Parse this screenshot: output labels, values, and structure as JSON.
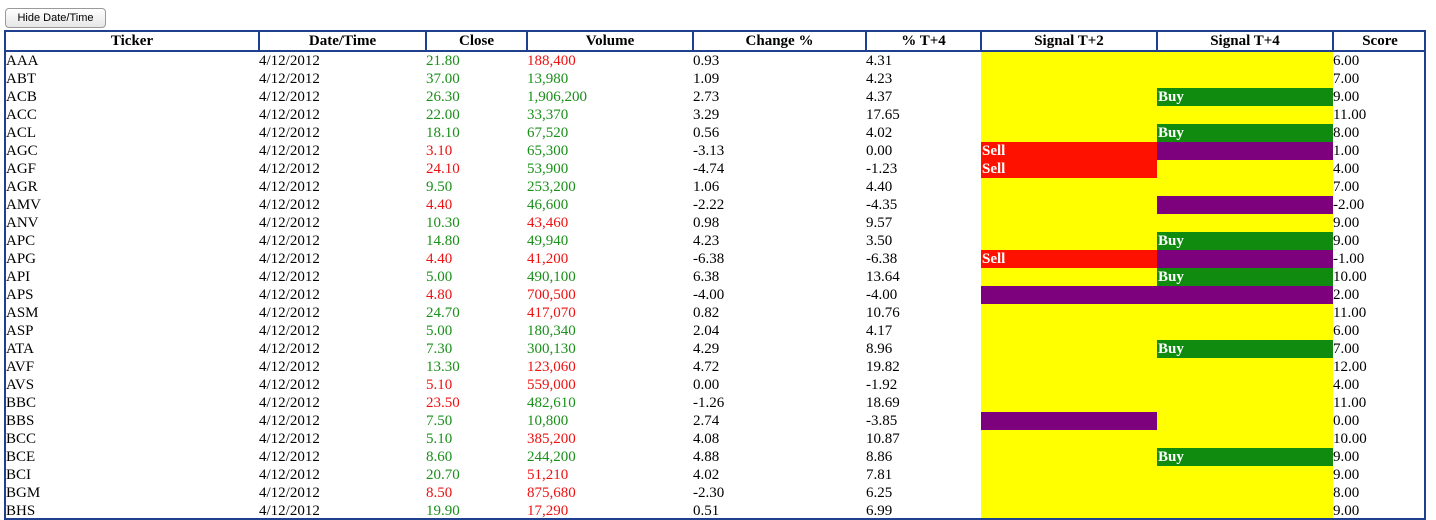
{
  "toolbar": {
    "toggle_label": "Hide Date/Time"
  },
  "colors": {
    "up": "#1a8f1a",
    "down": "#ee1111",
    "signal_bg": "#ffff00",
    "buy": "#108b10",
    "sell": "#ff1100",
    "purple": "#7d007d",
    "border": "#1f3f8f"
  },
  "table": {
    "headers": [
      "Ticker",
      "Date/Time",
      "Close",
      "Volume",
      "Change %",
      "% T+4",
      "Signal T+2",
      "Signal T+4",
      "Score"
    ],
    "rows": [
      {
        "ticker": "AAA",
        "date": "4/12/2012",
        "close": "21.80",
        "close_dir": "up",
        "volume": "188,400",
        "volume_dir": "down",
        "change": "0.93",
        "t4": "4.31",
        "sig2_kind": "none",
        "sig2": "",
        "sig4_kind": "none",
        "sig4": "",
        "score": "6.00"
      },
      {
        "ticker": "ABT",
        "date": "4/12/2012",
        "close": "37.00",
        "close_dir": "up",
        "volume": "13,980",
        "volume_dir": "up",
        "change": "1.09",
        "t4": "4.23",
        "sig2_kind": "none",
        "sig2": "",
        "sig4_kind": "none",
        "sig4": "",
        "score": "7.00"
      },
      {
        "ticker": "ACB",
        "date": "4/12/2012",
        "close": "26.30",
        "close_dir": "up",
        "volume": "1,906,200",
        "volume_dir": "up",
        "change": "2.73",
        "t4": "4.37",
        "sig2_kind": "none",
        "sig2": "",
        "sig4_kind": "buy",
        "sig4": "Buy",
        "score": "9.00"
      },
      {
        "ticker": "ACC",
        "date": "4/12/2012",
        "close": "22.00",
        "close_dir": "up",
        "volume": "33,370",
        "volume_dir": "up",
        "change": "3.29",
        "t4": "17.65",
        "sig2_kind": "none",
        "sig2": "",
        "sig4_kind": "none",
        "sig4": "",
        "score": "11.00"
      },
      {
        "ticker": "ACL",
        "date": "4/12/2012",
        "close": "18.10",
        "close_dir": "up",
        "volume": "67,520",
        "volume_dir": "up",
        "change": "0.56",
        "t4": "4.02",
        "sig2_kind": "none",
        "sig2": "",
        "sig4_kind": "buy",
        "sig4": "Buy",
        "score": "8.00"
      },
      {
        "ticker": "AGC",
        "date": "4/12/2012",
        "close": "3.10",
        "close_dir": "down",
        "volume": "65,300",
        "volume_dir": "up",
        "change": "-3.13",
        "t4": "0.00",
        "sig2_kind": "sell",
        "sig2": "Sell",
        "sig4_kind": "purple",
        "sig4": "",
        "score": "1.00"
      },
      {
        "ticker": "AGF",
        "date": "4/12/2012",
        "close": "24.10",
        "close_dir": "down",
        "volume": "53,900",
        "volume_dir": "up",
        "change": "-4.74",
        "t4": "-1.23",
        "sig2_kind": "sell",
        "sig2": "Sell",
        "sig4_kind": "none",
        "sig4": "",
        "score": "4.00"
      },
      {
        "ticker": "AGR",
        "date": "4/12/2012",
        "close": "9.50",
        "close_dir": "up",
        "volume": "253,200",
        "volume_dir": "up",
        "change": "1.06",
        "t4": "4.40",
        "sig2_kind": "none",
        "sig2": "",
        "sig4_kind": "none",
        "sig4": "",
        "score": "7.00"
      },
      {
        "ticker": "AMV",
        "date": "4/12/2012",
        "close": "4.40",
        "close_dir": "down",
        "volume": "46,600",
        "volume_dir": "up",
        "change": "-2.22",
        "t4": "-4.35",
        "sig2_kind": "none",
        "sig2": "",
        "sig4_kind": "purple",
        "sig4": "",
        "score": "-2.00"
      },
      {
        "ticker": "ANV",
        "date": "4/12/2012",
        "close": "10.30",
        "close_dir": "up",
        "volume": "43,460",
        "volume_dir": "down",
        "change": "0.98",
        "t4": "9.57",
        "sig2_kind": "none",
        "sig2": "",
        "sig4_kind": "none",
        "sig4": "",
        "score": "9.00"
      },
      {
        "ticker": "APC",
        "date": "4/12/2012",
        "close": "14.80",
        "close_dir": "up",
        "volume": "49,940",
        "volume_dir": "up",
        "change": "4.23",
        "t4": "3.50",
        "sig2_kind": "none",
        "sig2": "",
        "sig4_kind": "buy",
        "sig4": "Buy",
        "score": "9.00"
      },
      {
        "ticker": "APG",
        "date": "4/12/2012",
        "close": "4.40",
        "close_dir": "down",
        "volume": "41,200",
        "volume_dir": "down",
        "change": "-6.38",
        "t4": "-6.38",
        "sig2_kind": "sell",
        "sig2": "Sell",
        "sig4_kind": "purple",
        "sig4": "",
        "score": "-1.00"
      },
      {
        "ticker": "API",
        "date": "4/12/2012",
        "close": "5.00",
        "close_dir": "up",
        "volume": "490,100",
        "volume_dir": "up",
        "change": "6.38",
        "t4": "13.64",
        "sig2_kind": "none",
        "sig2": "",
        "sig4_kind": "buy",
        "sig4": "Buy",
        "score": "10.00"
      },
      {
        "ticker": "APS",
        "date": "4/12/2012",
        "close": "4.80",
        "close_dir": "down",
        "volume": "700,500",
        "volume_dir": "down",
        "change": "-4.00",
        "t4": "-4.00",
        "sig2_kind": "purple",
        "sig2": "",
        "sig4_kind": "purple",
        "sig4": "",
        "score": "2.00"
      },
      {
        "ticker": "ASM",
        "date": "4/12/2012",
        "close": "24.70",
        "close_dir": "up",
        "volume": "417,070",
        "volume_dir": "down",
        "change": "0.82",
        "t4": "10.76",
        "sig2_kind": "none",
        "sig2": "",
        "sig4_kind": "none",
        "sig4": "",
        "score": "11.00"
      },
      {
        "ticker": "ASP",
        "date": "4/12/2012",
        "close": "5.00",
        "close_dir": "up",
        "volume": "180,340",
        "volume_dir": "up",
        "change": "2.04",
        "t4": "4.17",
        "sig2_kind": "none",
        "sig2": "",
        "sig4_kind": "none",
        "sig4": "",
        "score": "6.00"
      },
      {
        "ticker": "ATA",
        "date": "4/12/2012",
        "close": "7.30",
        "close_dir": "up",
        "volume": "300,130",
        "volume_dir": "up",
        "change": "4.29",
        "t4": "8.96",
        "sig2_kind": "none",
        "sig2": "",
        "sig4_kind": "buy",
        "sig4": "Buy",
        "score": "7.00"
      },
      {
        "ticker": "AVF",
        "date": "4/12/2012",
        "close": "13.30",
        "close_dir": "up",
        "volume": "123,060",
        "volume_dir": "down",
        "change": "4.72",
        "t4": "19.82",
        "sig2_kind": "none",
        "sig2": "",
        "sig4_kind": "none",
        "sig4": "",
        "score": "12.00"
      },
      {
        "ticker": "AVS",
        "date": "4/12/2012",
        "close": "5.10",
        "close_dir": "down",
        "volume": "559,000",
        "volume_dir": "down",
        "change": "0.00",
        "t4": "-1.92",
        "sig2_kind": "none",
        "sig2": "",
        "sig4_kind": "none",
        "sig4": "",
        "score": "4.00"
      },
      {
        "ticker": "BBC",
        "date": "4/12/2012",
        "close": "23.50",
        "close_dir": "down",
        "volume": "482,610",
        "volume_dir": "up",
        "change": "-1.26",
        "t4": "18.69",
        "sig2_kind": "none",
        "sig2": "",
        "sig4_kind": "none",
        "sig4": "",
        "score": "11.00"
      },
      {
        "ticker": "BBS",
        "date": "4/12/2012",
        "close": "7.50",
        "close_dir": "up",
        "volume": "10,800",
        "volume_dir": "up",
        "change": "2.74",
        "t4": "-3.85",
        "sig2_kind": "purple",
        "sig2": "",
        "sig4_kind": "none",
        "sig4": "",
        "score": "0.00"
      },
      {
        "ticker": "BCC",
        "date": "4/12/2012",
        "close": "5.10",
        "close_dir": "up",
        "volume": "385,200",
        "volume_dir": "down",
        "change": "4.08",
        "t4": "10.87",
        "sig2_kind": "none",
        "sig2": "",
        "sig4_kind": "none",
        "sig4": "",
        "score": "10.00"
      },
      {
        "ticker": "BCE",
        "date": "4/12/2012",
        "close": "8.60",
        "close_dir": "up",
        "volume": "244,200",
        "volume_dir": "up",
        "change": "4.88",
        "t4": "8.86",
        "sig2_kind": "none",
        "sig2": "",
        "sig4_kind": "buy",
        "sig4": "Buy",
        "score": "9.00"
      },
      {
        "ticker": "BCI",
        "date": "4/12/2012",
        "close": "20.70",
        "close_dir": "up",
        "volume": "51,210",
        "volume_dir": "down",
        "change": "4.02",
        "t4": "7.81",
        "sig2_kind": "none",
        "sig2": "",
        "sig4_kind": "none",
        "sig4": "",
        "score": "9.00"
      },
      {
        "ticker": "BGM",
        "date": "4/12/2012",
        "close": "8.50",
        "close_dir": "down",
        "volume": "875,680",
        "volume_dir": "down",
        "change": "-2.30",
        "t4": "6.25",
        "sig2_kind": "none",
        "sig2": "",
        "sig4_kind": "none",
        "sig4": "",
        "score": "8.00"
      },
      {
        "ticker": "BHS",
        "date": "4/12/2012",
        "close": "19.90",
        "close_dir": "up",
        "volume": "17,290",
        "volume_dir": "down",
        "change": "0.51",
        "t4": "6.99",
        "sig2_kind": "none",
        "sig2": "",
        "sig4_kind": "none",
        "sig4": "",
        "score": "9.00"
      }
    ]
  }
}
